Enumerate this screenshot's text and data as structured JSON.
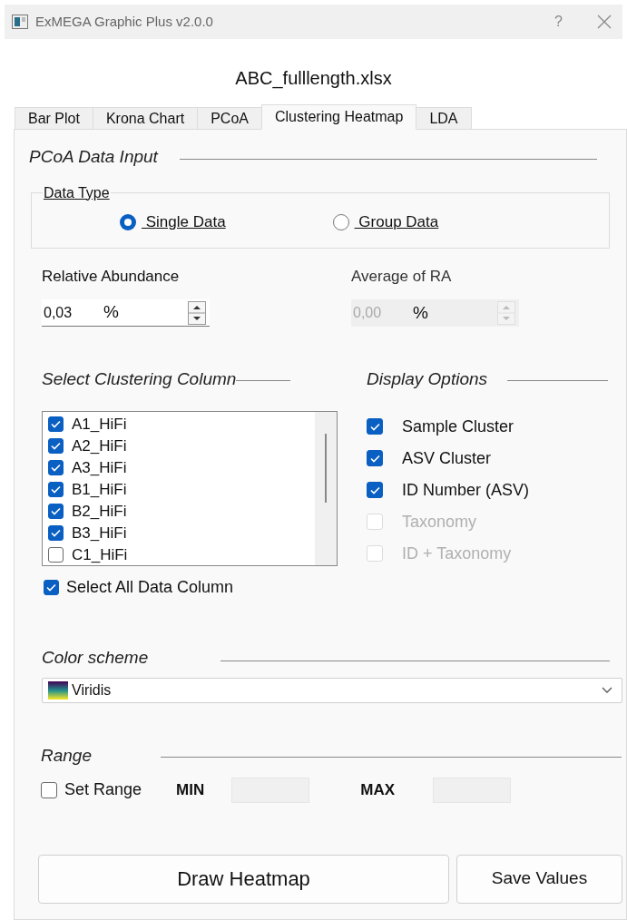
{
  "window": {
    "title": "ExMEGA Graphic Plus v2.0.0",
    "help": "?"
  },
  "file_name": "ABC_fulllength.xlsx",
  "tabs": [
    {
      "label": "Bar Plot",
      "selected": false
    },
    {
      "label": "Krona Chart",
      "selected": false
    },
    {
      "label": "PCoA",
      "selected": false
    },
    {
      "label": "Clustering Heatmap",
      "selected": true
    },
    {
      "label": "LDA",
      "selected": false
    }
  ],
  "data_input": {
    "title": "PCoA Data Input",
    "data_type": {
      "title": "Data Type",
      "options": [
        {
          "label": " Single Data",
          "selected": true
        },
        {
          "label": " Group Data",
          "selected": false
        }
      ]
    }
  },
  "spinboxes": [
    {
      "label": "Relative Abundance",
      "value": "0,03",
      "unit": "%",
      "disabled": false
    },
    {
      "label": "Average of RA",
      "value": "0,00",
      "unit": "%",
      "disabled": true
    }
  ],
  "clustering": {
    "title": "Select Clustering Column",
    "columns": [
      {
        "label": "A1_HiFi",
        "checked": true
      },
      {
        "label": "A2_HiFi",
        "checked": true
      },
      {
        "label": "A3_HiFi",
        "checked": true
      },
      {
        "label": "B1_HiFi",
        "checked": true
      },
      {
        "label": "B2_HiFi",
        "checked": true
      },
      {
        "label": "B3_HiFi",
        "checked": true
      },
      {
        "label": "C1_HiFi",
        "checked": false
      }
    ],
    "select_all": {
      "label": "Select All Data Column",
      "checked": true
    }
  },
  "display_options": {
    "title": "Display Options",
    "options": [
      {
        "label": "Sample Cluster",
        "checked": true,
        "disabled": false
      },
      {
        "label": "ASV Cluster",
        "checked": true,
        "disabled": false
      },
      {
        "label": "ID Number (ASV)",
        "checked": true,
        "disabled": false
      },
      {
        "label": "Taxonomy",
        "checked": false,
        "disabled": true
      },
      {
        "label": "ID + Taxonomy",
        "checked": false,
        "disabled": true
      }
    ]
  },
  "color_scheme": {
    "title": "Color scheme",
    "value": "Viridis"
  },
  "range": {
    "title": "Range",
    "set_range": {
      "label": "Set Range",
      "checked": false
    },
    "min_label": "MIN",
    "max_label": "MAX"
  },
  "buttons": [
    "Draw Heatmap",
    "Save Values"
  ]
}
